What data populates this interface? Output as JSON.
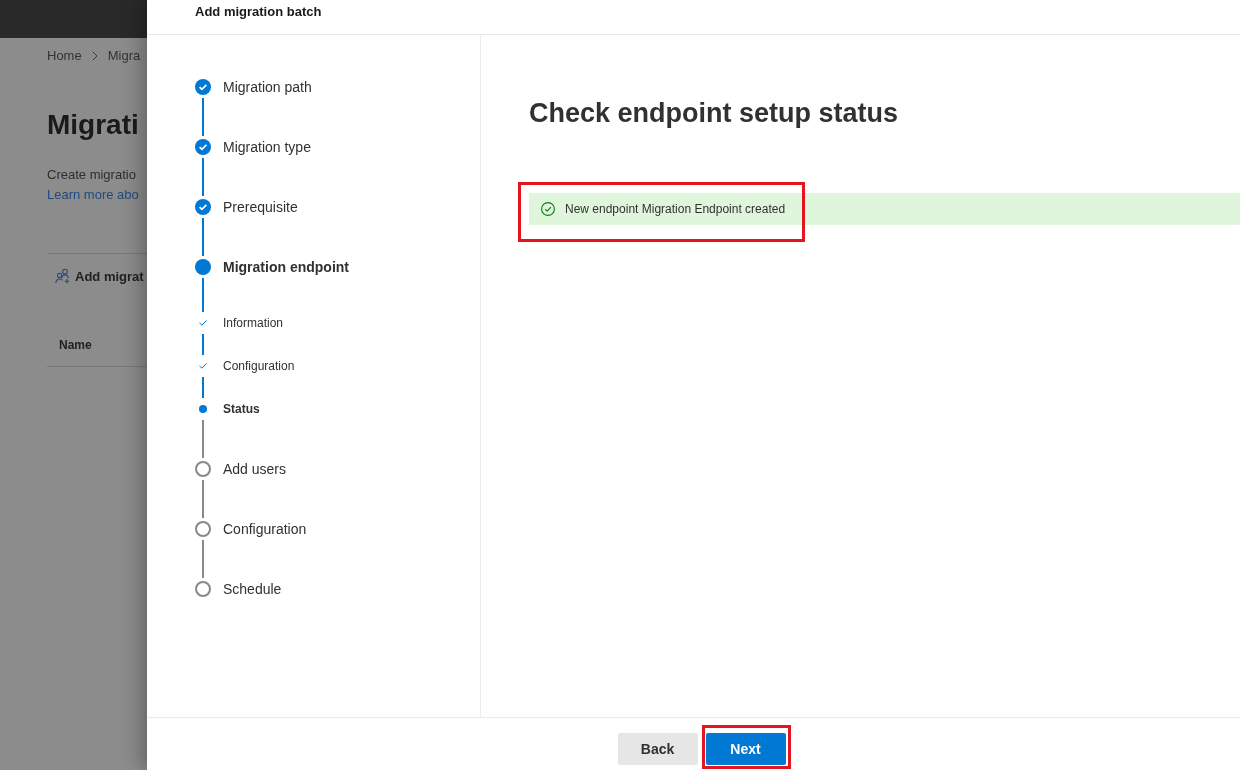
{
  "background_page": {
    "breadcrumb": [
      "Home",
      "Migra"
    ],
    "title": "Migrati",
    "description": "Create migratio",
    "link": "Learn more abo",
    "toolbar": {
      "add_button": "Add migrat"
    },
    "table": {
      "columns": [
        "Name"
      ]
    }
  },
  "panel": {
    "title": "Add migration batch",
    "steps": [
      {
        "label": "Migration path",
        "completed": true,
        "selected": false
      },
      {
        "label": "Migration type",
        "completed": true,
        "selected": false
      },
      {
        "label": "Prerequisite",
        "completed": true,
        "selected": false
      },
      {
        "label": "Migration endpoint",
        "completed": false,
        "selected": true,
        "children": [
          {
            "label": "Information",
            "completed": true,
            "selected": false
          },
          {
            "label": "Configuration",
            "completed": true,
            "selected": false
          },
          {
            "label": "Status",
            "completed": false,
            "selected": true
          }
        ]
      },
      {
        "label": "Add users",
        "completed": false,
        "selected": false
      },
      {
        "label": "Configuration",
        "completed": false,
        "selected": false
      },
      {
        "label": "Schedule",
        "completed": false,
        "selected": false
      }
    ],
    "content": {
      "heading": "Check endpoint setup status",
      "message": {
        "kind": "success",
        "text": "New endpoint Migration Endpoint created",
        "highlighted": true
      }
    },
    "footer": {
      "buttons": [
        {
          "label": "Back",
          "primary": false,
          "highlighted": false
        },
        {
          "label": "Next",
          "primary": true,
          "highlighted": true
        }
      ]
    }
  }
}
